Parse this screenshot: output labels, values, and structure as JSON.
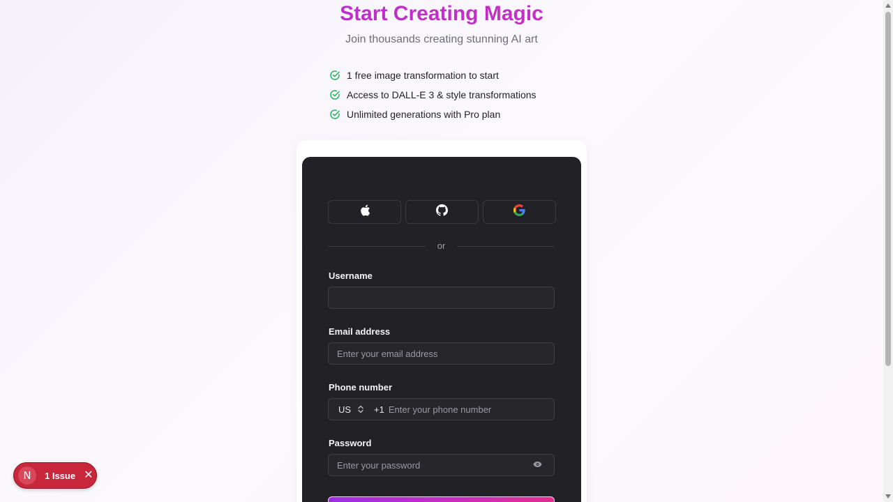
{
  "hero": {
    "title": "Start Creating Magic",
    "subtitle": "Join thousands creating stunning AI art"
  },
  "features": [
    "1 free image transformation to start",
    "Access to DALL-E 3 & style transformations",
    "Unlimited generations with Pro plan"
  ],
  "form": {
    "social": {
      "apple": "apple-icon",
      "github": "github-icon",
      "google": "google-icon"
    },
    "divider": "or",
    "username": {
      "label": "Username",
      "value": "",
      "placeholder": ""
    },
    "email": {
      "label": "Email address",
      "placeholder": "Enter your email address"
    },
    "phone": {
      "label": "Phone number",
      "country": "US",
      "dial_code": "+1",
      "placeholder": "Enter your phone number"
    },
    "password": {
      "label": "Password",
      "placeholder": "Enter your password"
    }
  },
  "dev_overlay": {
    "logo": "N",
    "issues_label": "1 Issue"
  },
  "colors": {
    "accent_start": "#b12ad6",
    "accent_end": "#cf30b0",
    "card_bg": "#212126",
    "check_green": "#22b35e",
    "issue_red": "#c8263a"
  }
}
